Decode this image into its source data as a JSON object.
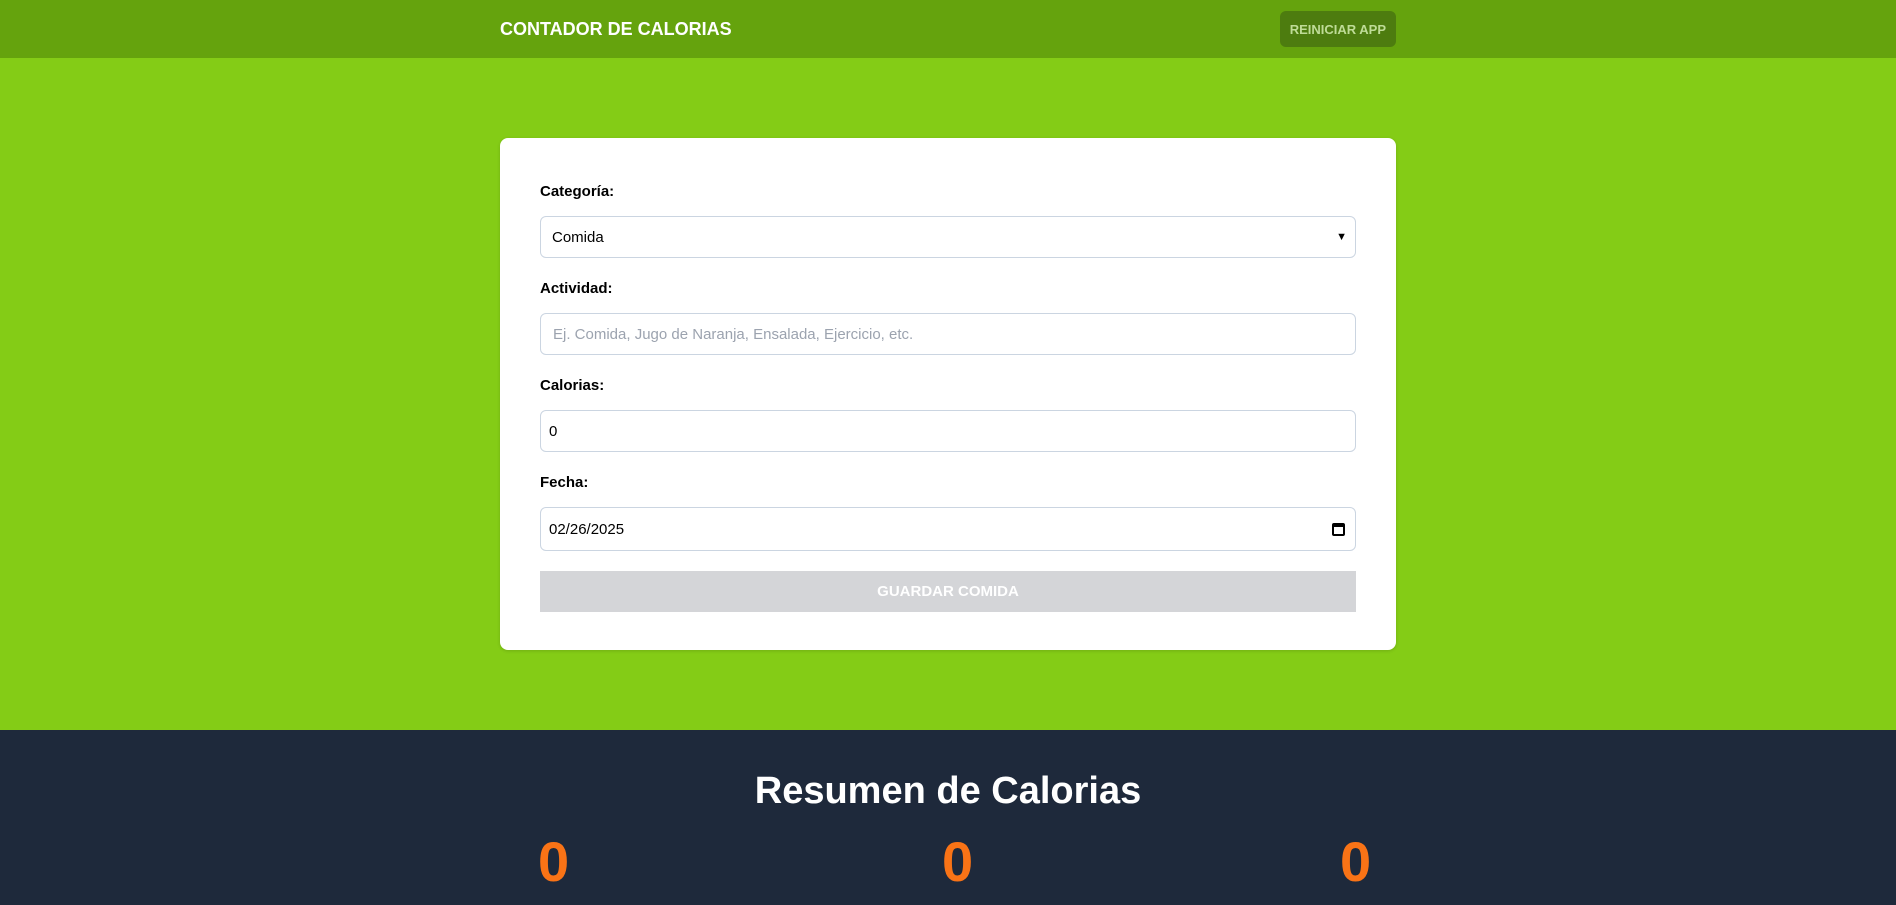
{
  "header": {
    "title": "CONTADOR DE CALORIAS",
    "reset_label": "REINICIAR APP"
  },
  "form": {
    "category_label": "Categoría:",
    "category_value": "Comida",
    "activity_label": "Actividad:",
    "activity_placeholder": "Ej. Comida, Jugo de Naranja, Ensalada, Ejercicio, etc.",
    "calories_label": "Calorias:",
    "calories_value": "0",
    "date_label": "Fecha:",
    "date_value": "02/26/2025",
    "submit_label": "GUARDAR COMIDA"
  },
  "summary": {
    "title": "Resumen de Calorias",
    "values": [
      "0",
      "0",
      "0"
    ]
  }
}
